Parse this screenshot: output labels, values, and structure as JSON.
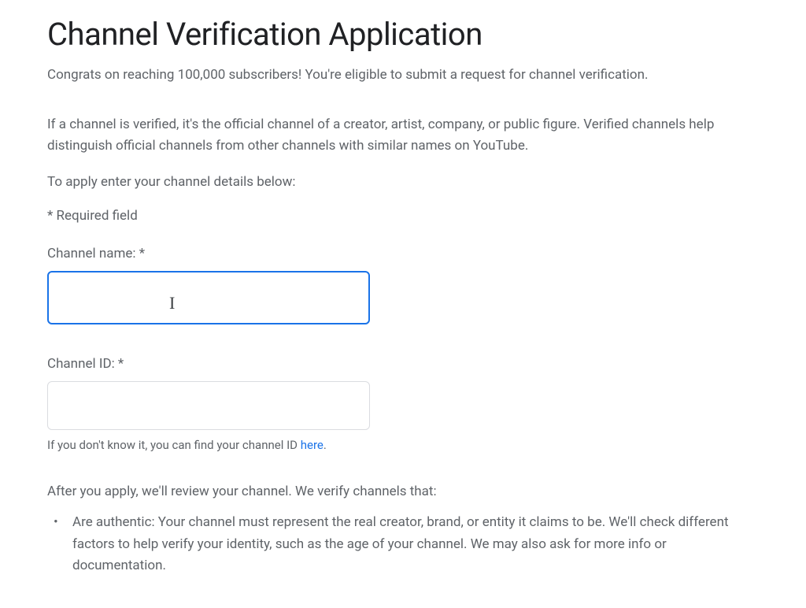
{
  "title": "Channel Verification Application",
  "intro": "Congrats on reaching 100,000 subscribers! You're eligible to submit a request for channel verification.",
  "description": "If a channel is verified, it's the official channel of a creator, artist, company, or public figure. Verified channels help distinguish official channels from other channels with similar names on YouTube.",
  "instruction": "To apply enter your channel details below:",
  "required_note": "* Required field",
  "fields": {
    "channel_name": {
      "label": "Channel name: *",
      "value": ""
    },
    "channel_id": {
      "label": "Channel ID: *",
      "value": "",
      "help_prefix": "If you don't know it, you can find your channel ID ",
      "help_link": "here",
      "help_suffix": "."
    }
  },
  "review": {
    "heading": "After you apply, we'll review your channel. We verify channels that:",
    "items": [
      "Are authentic: Your channel must represent the real creator, brand, or entity it claims to be. We'll check different factors to help verify your identity, such as the age of your channel. We may also ask for more info or documentation."
    ]
  }
}
